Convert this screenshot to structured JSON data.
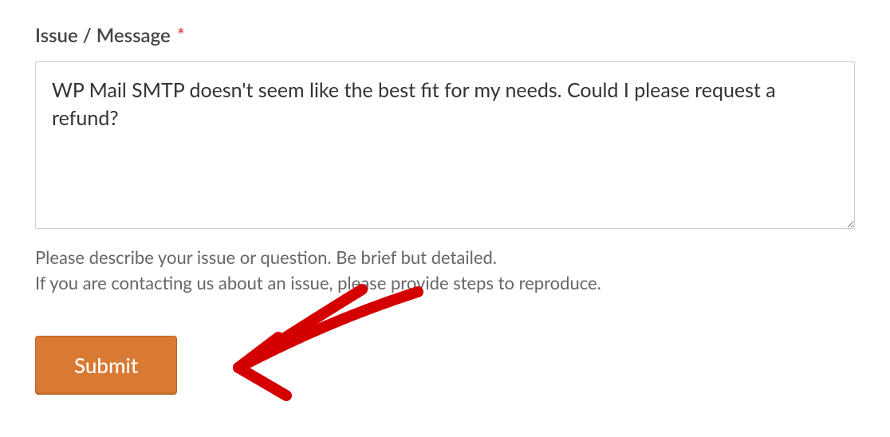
{
  "form": {
    "label": "Issue / Message",
    "required_mark": "*",
    "textarea_value": "WP Mail SMTP doesn't seem like the best fit for my needs. Could I please request a refund?",
    "help_text_line1": "Please describe your issue or question. Be brief but detailed.",
    "help_text_line2": "If you are contacting us about an issue, please provide steps to reproduce.",
    "submit_label": "Submit"
  },
  "annotation": {
    "type": "arrow",
    "color": "#d40000"
  }
}
